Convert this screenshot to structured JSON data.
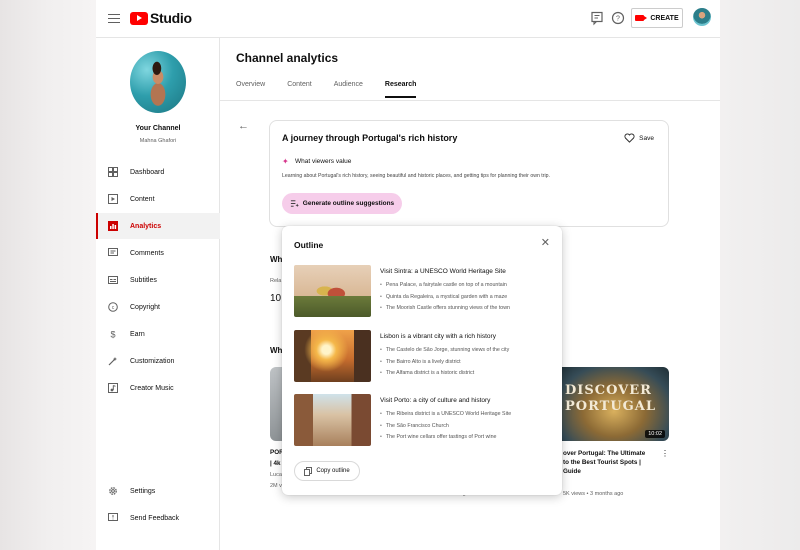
{
  "app": {
    "logo_text": "Studio",
    "create_label": "CREATE"
  },
  "sidebar": {
    "your_channel": "Your Channel",
    "channel_name": "Mahna Ghafori",
    "items": [
      {
        "label": "Dashboard",
        "icon": "dashboard-icon"
      },
      {
        "label": "Content",
        "icon": "content-icon"
      },
      {
        "label": "Analytics",
        "icon": "analytics-icon",
        "active": true
      },
      {
        "label": "Comments",
        "icon": "comments-icon"
      },
      {
        "label": "Subtitles",
        "icon": "subtitles-icon"
      },
      {
        "label": "Copyright",
        "icon": "copyright-icon"
      },
      {
        "label": "Earn",
        "icon": "earn-icon"
      },
      {
        "label": "Customization",
        "icon": "customization-icon"
      },
      {
        "label": "Creator Music",
        "icon": "music-icon"
      }
    ],
    "settings": "Settings",
    "feedback": "Send Feedback"
  },
  "main": {
    "title": "Channel analytics",
    "tabs": [
      "Overview",
      "Content",
      "Audience",
      "Research"
    ],
    "active_tab": "Research"
  },
  "topic": {
    "title": "A journey through Portugal's rich history",
    "save_label": "Save",
    "wvv_label": "What viewers value",
    "wvv_text": "Learning about Portugal's rich history, seeing beautiful and historic places, and getting tips for planning their own trip.",
    "generate_label": "Generate outline suggestions"
  },
  "background": {
    "heading1": "Wh",
    "small1": "Rela",
    "number1": "10",
    "heading2": "Wh",
    "left_title1": "POR",
    "left_title2": "| 4k",
    "left_meta1": "Luca",
    "left_meta2": "2M v",
    "behind_meta": "370 views • 4 months ago",
    "right_thumb_text": "DISCOVER PORTUGAL",
    "right_duration": "10:02",
    "right_title": "Discover Portugal: The Ultimate Guide to the Best Tourist Spots | Guide",
    "right_title_visible": "over Portugal: The Ultimate\nto the Best Tourist Spots |\nGuide",
    "right_meta": "...k views • 3 months ago",
    "right_meta_visible": "uide",
    "right_meta2_visible": "5K views • 3 months ago"
  },
  "outline": {
    "title": "Outline",
    "items": [
      {
        "heading": "Visit Sintra: a UNESCO World Heritage Site",
        "bullets": [
          "Pena Palace, a fairytale castle on top of a mountain",
          "Quinta da Regaleira, a mystical garden with a maze",
          "The Moorish Castle offers stunning views of the town"
        ]
      },
      {
        "heading": "Lisbon is a vibrant city with a rich history",
        "bullets": [
          "The Castelo de São Jorge, stunning views of the city",
          "The Bairro Alto is a lively district",
          "The Alfama district is a historic district"
        ]
      },
      {
        "heading": "Visit Porto: a city of culture and history",
        "bullets": [
          "The Ribeira district is a UNESCO World Heritage Site",
          "The São Francisco Church",
          "The Port wine cellars offer tastings of Port wine"
        ]
      }
    ],
    "copy_label": "Copy outline"
  },
  "colors": {
    "brand_red": "#ff0000",
    "active_nav": "#cc0000",
    "generate_button_bg": "#f6cdea",
    "sparkle": "#d6358c"
  }
}
